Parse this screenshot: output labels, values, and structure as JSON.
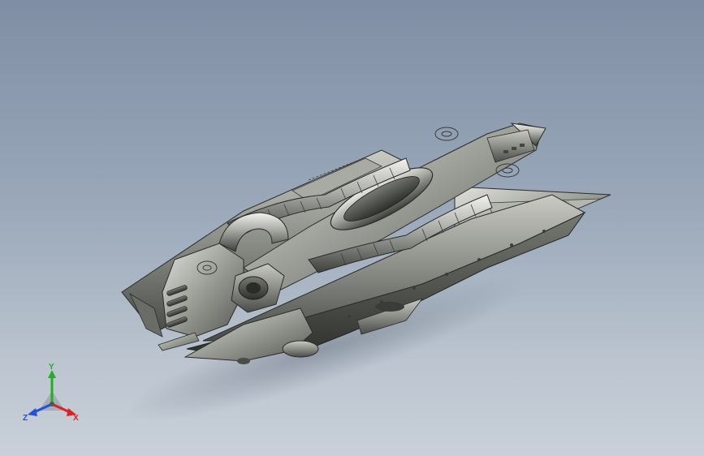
{
  "viewport": {
    "background_top": "#7f8ea4",
    "background_bottom": "#c9d0d9"
  },
  "model": {
    "icon": "isometric-spaceship-model",
    "material_color": "#8a8c86"
  },
  "triad": {
    "x_label": "X",
    "y_label": "Y",
    "z_label": "Z",
    "x_color": "#e02020",
    "y_color": "#22b022",
    "z_color": "#2050e0"
  }
}
